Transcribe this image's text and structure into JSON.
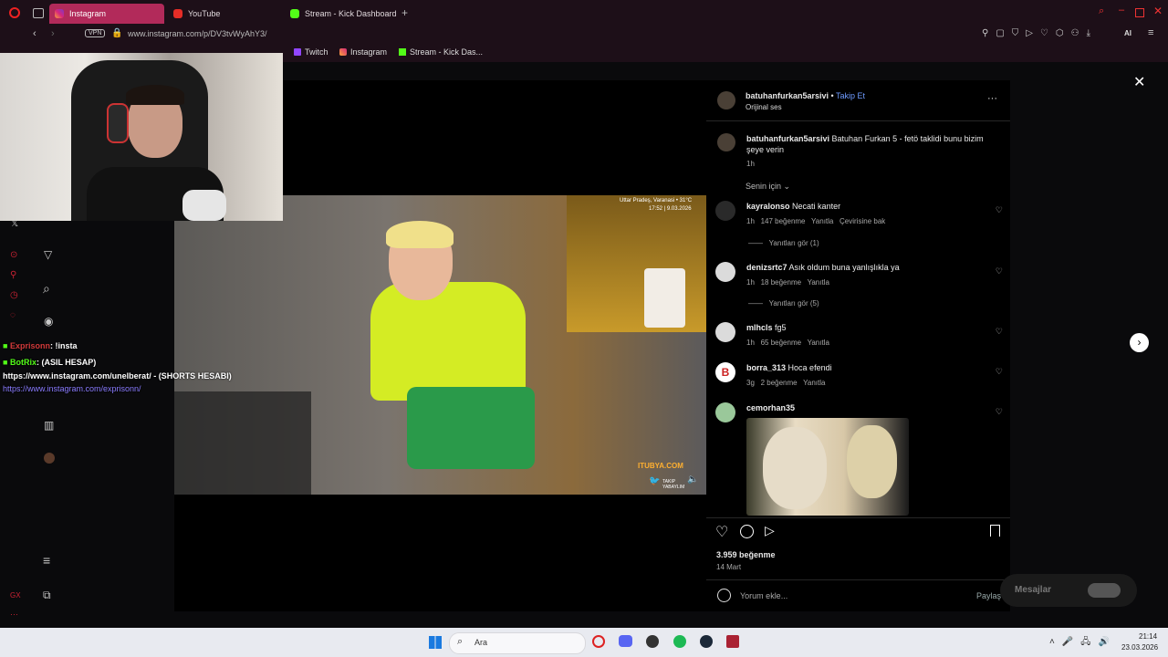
{
  "browser": {
    "tabs": [
      {
        "label": "Instagram",
        "active": true
      },
      {
        "label": "YouTube"
      },
      {
        "label": "Stream - Kick Dashboard"
      }
    ],
    "url": "www.instagram.com/p/DV3tvWyAhY3/",
    "vpn_label": "VPN",
    "ai_label": "AI",
    "bookmarks": [
      "Twitch",
      "Instagram",
      "Stream - Kick Das..."
    ]
  },
  "stream_chat": [
    {
      "user": "Exprisonn",
      "text": ": !insta"
    },
    {
      "user": "BotRix",
      "text": ": (ASIL HESAP)"
    },
    {
      "text": "https://www.instagram.com/unelberat/ - (SHORTS HESABI)"
    },
    {
      "text": "https://www.instagram.com/exprisonn/"
    }
  ],
  "video": {
    "caption_top": "Uttar Pradeş, Varanasi • 31°C",
    "caption_time": "17:52 | 9.03.2026",
    "watermark": "ITUBYA.COM",
    "watermark2": "TAKIP YABAYLIM"
  },
  "post": {
    "author": "batuhanfurkan5arsivi",
    "follow": "Takip Et",
    "audio": "Orijinal ses",
    "caption_user": "batuhanfurkan5arsivi",
    "caption_text": "Batuhan Furkan 5 - fetö taklidi bunu bizim şeye verin",
    "caption_time": "1h",
    "sort": "Senin için",
    "comments": [
      {
        "user": "kayralonso",
        "text": "Necati kanter",
        "time": "1h",
        "likes": "147 beğenme",
        "reply": "Yanıtla",
        "extra": "Çevirisine bak",
        "replies": "Yanıtları gör (1)"
      },
      {
        "user": "denizsrtc7",
        "text": "Asık oldum buna yanlışlıkla ya",
        "time": "1h",
        "likes": "18 beğenme",
        "reply": "Yanıtla",
        "replies": "Yanıtları gör (5)"
      },
      {
        "user": "mlhcls",
        "text": "fg5",
        "time": "1h",
        "likes": "65 beğenme",
        "reply": "Yanıtla"
      },
      {
        "user": "borra_313",
        "text": "Hoca efendi",
        "time": "3g",
        "likes": "2 beğenme",
        "reply": "Yanıtla"
      },
      {
        "user": "cemorhan35",
        "text": ""
      }
    ],
    "likes": "3.959 beğenme",
    "date": "14 Mart",
    "comment_placeholder": "Yorum ekle...",
    "share": "Paylaş"
  },
  "messages_label": "Mesajlar",
  "taskbar": {
    "search": "Ara",
    "time": "21:14",
    "date": "23.03.2026"
  },
  "colors": {
    "accent": "#b22a5a",
    "link": "#6e9bff",
    "kick": "#53fc18"
  }
}
